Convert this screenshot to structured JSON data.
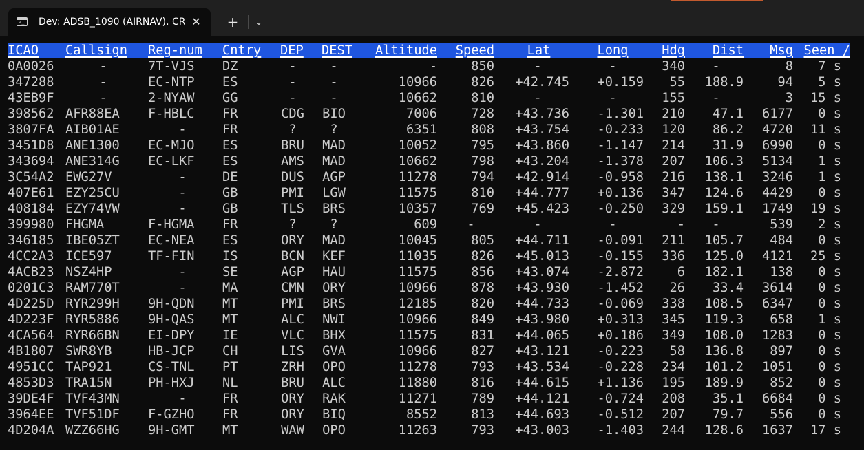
{
  "window": {
    "tab_title": "Dev: ADSB_1090 (AIRNAV). CR",
    "tab_icon": "terminal-icon",
    "tab_icon_glyph": ">_",
    "close_glyph": "✕",
    "new_tab_glyph": "+",
    "dropdown_glyph": "⌄"
  },
  "colors": {
    "header_highlight": "#1f56e0",
    "background": "#0c0c0c",
    "text": "#cccccc"
  },
  "table": {
    "columns": [
      "ICAO",
      "Callsign",
      "Reg-num",
      "Cntry",
      "DEP",
      "DEST",
      "Altitude",
      "Speed",
      "Lat",
      "Long",
      "Hdg",
      "Dist",
      "Msg",
      "Seen /"
    ],
    "rows": [
      [
        "0A0026",
        "-",
        "7T-VJS",
        "DZ",
        "-",
        "-",
        "-",
        "850",
        "-",
        "-",
        "340",
        "-",
        "8",
        "7 s"
      ],
      [
        "347288",
        "-",
        "EC-NTP",
        "ES",
        "-",
        "-",
        "10966",
        "826",
        "+42.745",
        "+0.159",
        "55",
        "188.9",
        "94",
        "5 s"
      ],
      [
        "43EB9F",
        "-",
        "2-NYAW",
        "GG",
        "-",
        "-",
        "10662",
        "810",
        "-",
        "-",
        "155",
        "-",
        "3",
        "15 s"
      ],
      [
        "398562",
        "AFR88EA",
        "F-HBLC",
        "FR",
        "CDG",
        "BIO",
        "7006",
        "728",
        "+43.736",
        "-1.301",
        "210",
        "47.1",
        "6177",
        "0 s"
      ],
      [
        "3807FA",
        "AIB01AE",
        "-",
        "FR",
        "?",
        "?",
        "6351",
        "808",
        "+43.754",
        "-0.233",
        "120",
        "86.2",
        "4720",
        "11 s"
      ],
      [
        "3451D8",
        "ANE1300",
        "EC-MJO",
        "ES",
        "BRU",
        "MAD",
        "10052",
        "795",
        "+43.860",
        "-1.147",
        "214",
        "31.9",
        "6990",
        "0 s"
      ],
      [
        "343694",
        "ANE314G",
        "EC-LKF",
        "ES",
        "AMS",
        "MAD",
        "10662",
        "798",
        "+43.204",
        "-1.378",
        "207",
        "106.3",
        "5134",
        "1 s"
      ],
      [
        "3C54A2",
        "EWG27V",
        "-",
        "DE",
        "DUS",
        "AGP",
        "11278",
        "794",
        "+42.914",
        "-0.958",
        "216",
        "138.1",
        "3246",
        "1 s"
      ],
      [
        "407E61",
        "EZY25CU",
        "-",
        "GB",
        "PMI",
        "LGW",
        "11575",
        "810",
        "+44.777",
        "+0.136",
        "347",
        "124.6",
        "4429",
        "0 s"
      ],
      [
        "408184",
        "EZY74VW",
        "-",
        "GB",
        "TLS",
        "BRS",
        "10357",
        "769",
        "+45.423",
        "-0.250",
        "329",
        "159.1",
        "1749",
        "19 s"
      ],
      [
        "399980",
        "FHGMA",
        "F-HGMA",
        "FR",
        "?",
        "?",
        "609",
        "-",
        "-",
        "-",
        "-",
        "-",
        "539",
        "2 s"
      ],
      [
        "346185",
        "IBE05ZT",
        "EC-NEA",
        "ES",
        "ORY",
        "MAD",
        "10045",
        "805",
        "+44.711",
        "-0.091",
        "211",
        "105.7",
        "484",
        "0 s"
      ],
      [
        "4CC2A3",
        "ICE597",
        "TF-FIN",
        "IS",
        "BCN",
        "KEF",
        "11035",
        "826",
        "+45.013",
        "-0.155",
        "336",
        "125.0",
        "4121",
        "25 s"
      ],
      [
        "4ACB23",
        "NSZ4HP",
        "-",
        "SE",
        "AGP",
        "HAU",
        "11575",
        "856",
        "+43.074",
        "-2.872",
        "6",
        "182.1",
        "138",
        "0 s"
      ],
      [
        "0201C3",
        "RAM770T",
        "-",
        "MA",
        "CMN",
        "ORY",
        "10966",
        "878",
        "+43.930",
        "-1.452",
        "26",
        "33.4",
        "3614",
        "0 s"
      ],
      [
        "4D225D",
        "RYR299H",
        "9H-QDN",
        "MT",
        "PMI",
        "BRS",
        "12185",
        "820",
        "+44.733",
        "-0.069",
        "338",
        "108.5",
        "6347",
        "0 s"
      ],
      [
        "4D223F",
        "RYR5886",
        "9H-QAS",
        "MT",
        "ALC",
        "NWI",
        "10966",
        "849",
        "+43.980",
        "+0.313",
        "345",
        "119.3",
        "658",
        "1 s"
      ],
      [
        "4CA564",
        "RYR66BN",
        "EI-DPY",
        "IE",
        "VLC",
        "BHX",
        "11575",
        "831",
        "+44.065",
        "+0.186",
        "349",
        "108.0",
        "1283",
        "0 s"
      ],
      [
        "4B1807",
        "SWR8YB",
        "HB-JCP",
        "CH",
        "LIS",
        "GVA",
        "10966",
        "827",
        "+43.121",
        "-0.223",
        "58",
        "136.8",
        "897",
        "0 s"
      ],
      [
        "4951CC",
        "TAP921",
        "CS-TNL",
        "PT",
        "ZRH",
        "OPO",
        "11278",
        "793",
        "+43.534",
        "-0.228",
        "234",
        "101.2",
        "1051",
        "0 s"
      ],
      [
        "4853D3",
        "TRA15N",
        "PH-HXJ",
        "NL",
        "BRU",
        "ALC",
        "11880",
        "816",
        "+44.615",
        "+1.136",
        "195",
        "189.9",
        "852",
        "0 s"
      ],
      [
        "39DE4F",
        "TVF43MN",
        "-",
        "FR",
        "ORY",
        "RAK",
        "11271",
        "789",
        "+44.121",
        "-0.724",
        "208",
        "35.1",
        "6684",
        "0 s"
      ],
      [
        "3964EE",
        "TVF51DF",
        "F-GZHO",
        "FR",
        "ORY",
        "BIQ",
        "8552",
        "813",
        "+44.693",
        "-0.512",
        "207",
        "79.7",
        "556",
        "0 s"
      ],
      [
        "4D204A",
        "WZZ66HG",
        "9H-GMT",
        "MT",
        "WAW",
        "OPO",
        "11263",
        "793",
        "+43.003",
        "-1.403",
        "244",
        "128.6",
        "1637",
        "17 s"
      ]
    ]
  }
}
